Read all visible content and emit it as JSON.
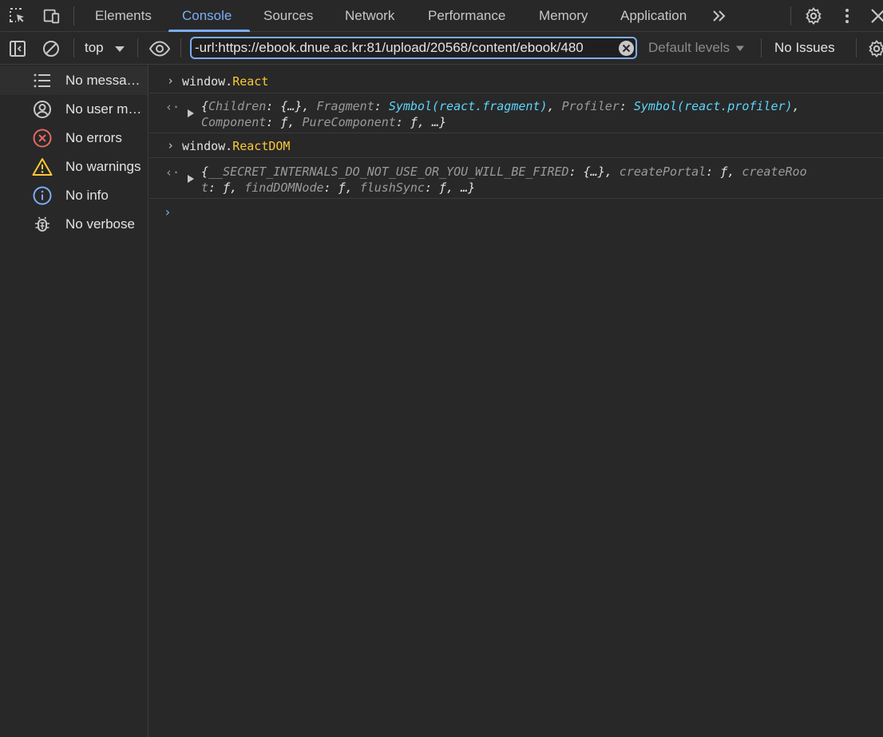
{
  "tabs": [
    "Elements",
    "Console",
    "Sources",
    "Network",
    "Performance",
    "Memory",
    "Application"
  ],
  "active_tab": "Console",
  "toolbar": {
    "context": "top",
    "filter_value": "-url:https://ebook.dnue.ac.kr:81/upload/20568/content/ebook/480",
    "levels": "Default levels",
    "issues": "No Issues"
  },
  "sidebar": {
    "items": [
      {
        "label": "No messa…",
        "icon": "list-icon"
      },
      {
        "label": "No user m…",
        "icon": "user-icon"
      },
      {
        "label": "No errors",
        "icon": "error-icon"
      },
      {
        "label": "No warnings",
        "icon": "warning-icon"
      },
      {
        "label": "No info",
        "icon": "info-icon"
      },
      {
        "label": "No verbose",
        "icon": "bug-icon"
      }
    ]
  },
  "console": {
    "entries": [
      {
        "input_prefix": "window.",
        "input_prop": "React",
        "output_line1": [
          {
            "t": "{",
            "c": "p"
          },
          {
            "t": "Children",
            "c": "k"
          },
          {
            "t": ": {…}, ",
            "c": "p"
          },
          {
            "t": "Fragment",
            "c": "k"
          },
          {
            "t": ": ",
            "c": "p"
          },
          {
            "t": "Symbol(react.fragment)",
            "c": "sym"
          },
          {
            "t": ", ",
            "c": "p"
          },
          {
            "t": "Profiler",
            "c": "k"
          },
          {
            "t": ": ",
            "c": "p"
          },
          {
            "t": "Symbol(react.profiler)",
            "c": "sym"
          },
          {
            "t": ",",
            "c": "p"
          }
        ],
        "output_line2": [
          {
            "t": "Component",
            "c": "k"
          },
          {
            "t": ": ƒ, ",
            "c": "p"
          },
          {
            "t": "PureComponent",
            "c": "k"
          },
          {
            "t": ": ƒ, …}",
            "c": "p"
          }
        ]
      },
      {
        "input_prefix": "window.",
        "input_prop": "ReactDOM",
        "output_line1": [
          {
            "t": "{",
            "c": "p"
          },
          {
            "t": "__SECRET_INTERNALS_DO_NOT_USE_OR_YOU_WILL_BE_FIRED",
            "c": "k"
          },
          {
            "t": ": {…}, ",
            "c": "p"
          },
          {
            "t": "createPortal",
            "c": "k"
          },
          {
            "t": ": ƒ, ",
            "c": "p"
          },
          {
            "t": "createRoo",
            "c": "k"
          }
        ],
        "output_line2": [
          {
            "t": "t",
            "c": "k"
          },
          {
            "t": ": ƒ, ",
            "c": "p"
          },
          {
            "t": "findDOMNode",
            "c": "k"
          },
          {
            "t": ": ƒ, ",
            "c": "p"
          },
          {
            "t": "flushSync",
            "c": "k"
          },
          {
            "t": ": ƒ, …}",
            "c": "p"
          }
        ]
      }
    ]
  },
  "colors": {
    "accent": "#7cacf8",
    "error": "#e46962",
    "warning": "#fcc934",
    "symbol": "#5cd5fb"
  }
}
